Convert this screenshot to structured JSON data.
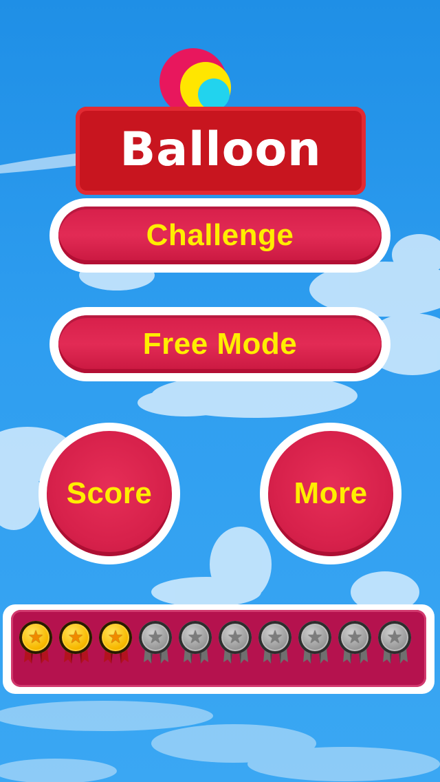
{
  "game": {
    "title": "Balloon",
    "plane_icon": "airplane-icon"
  },
  "menu": {
    "challenge_label": "Challenge",
    "free_mode_label": "Free Mode",
    "score_label": "Score",
    "more_label": "More"
  },
  "medals": {
    "earned": 3,
    "total": 10,
    "items": [
      {
        "state": "gold",
        "icon": "star-icon"
      },
      {
        "state": "gold",
        "icon": "star-icon"
      },
      {
        "state": "gold",
        "icon": "star-icon"
      },
      {
        "state": "silver",
        "icon": "star-icon"
      },
      {
        "state": "silver",
        "icon": "star-icon"
      },
      {
        "state": "silver",
        "icon": "star-icon"
      },
      {
        "state": "silver",
        "icon": "star-icon"
      },
      {
        "state": "silver",
        "icon": "star-icon"
      },
      {
        "state": "silver",
        "icon": "star-icon"
      },
      {
        "state": "silver",
        "icon": "star-icon"
      }
    ]
  },
  "colors": {
    "sky": "#2f9ef0",
    "button_red": "#d71f4a",
    "button_text": "#ffee00",
    "panel": "#b5124e"
  }
}
